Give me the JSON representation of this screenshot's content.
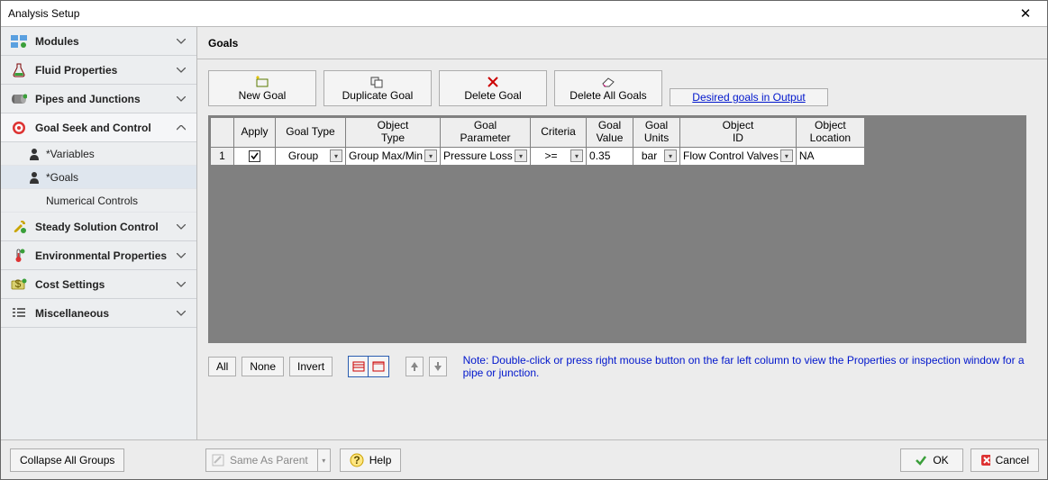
{
  "window": {
    "title": "Analysis Setup"
  },
  "sidebar": {
    "groups": [
      {
        "label": "Modules",
        "expanded": false
      },
      {
        "label": "Fluid Properties",
        "expanded": false
      },
      {
        "label": "Pipes and Junctions",
        "expanded": false
      },
      {
        "label": "Goal Seek and Control",
        "expanded": true,
        "children": [
          {
            "label": "*Variables"
          },
          {
            "label": "*Goals",
            "selected": true
          },
          {
            "label": "Numerical Controls",
            "plain": true
          }
        ]
      },
      {
        "label": "Steady Solution Control",
        "expanded": false
      },
      {
        "label": "Environmental Properties",
        "expanded": false
      },
      {
        "label": "Cost Settings",
        "expanded": false
      },
      {
        "label": "Miscellaneous",
        "expanded": false
      }
    ]
  },
  "main": {
    "title": "Goals",
    "toolbar": {
      "new_goal": "New Goal",
      "duplicate_goal": "Duplicate Goal",
      "delete_goal": "Delete Goal",
      "delete_all_goals": "Delete All Goals",
      "desired_output": "Desired goals in Output"
    },
    "columns": [
      "",
      "Apply",
      "Goal Type",
      "Object\nType",
      "Goal\nParameter",
      "Criteria",
      "Goal\nValue",
      "Goal\nUnits",
      "Object\nID",
      "Object\nLocation"
    ],
    "rows": [
      {
        "num": "1",
        "apply_checked": true,
        "goal_type": "Group",
        "object_type": "Group Max/Min",
        "goal_parameter": "Pressure Loss",
        "criteria": ">=",
        "goal_value": "0.35",
        "goal_units": "bar",
        "object_id": "Flow Control Valves",
        "object_location": "NA"
      }
    ],
    "selection": {
      "all": "All",
      "none": "None",
      "invert": "Invert"
    },
    "note": "Note: Double-click or press right mouse button on the far left column to view the Properties or inspection window for a pipe or junction."
  },
  "footer": {
    "collapse": "Collapse All Groups",
    "same_as_parent": "Same As Parent",
    "help": "Help",
    "ok": "OK",
    "cancel": "Cancel"
  }
}
